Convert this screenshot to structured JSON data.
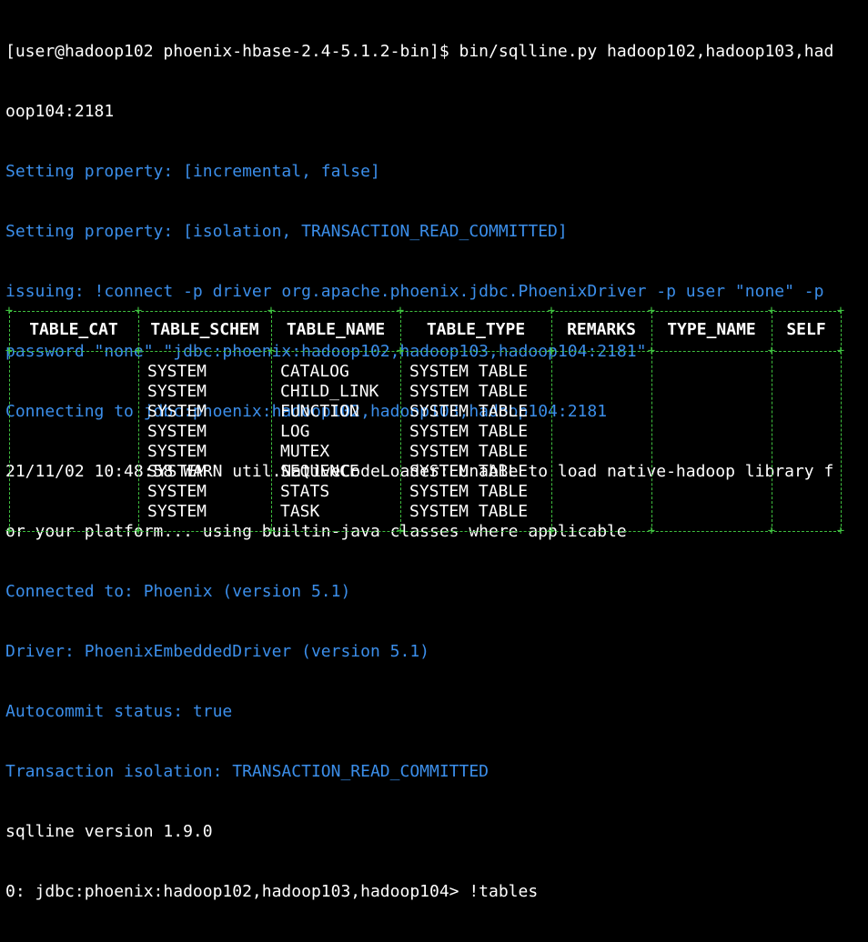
{
  "terminal": {
    "lines": [
      {
        "text": "[user@hadoop102 phoenix-hbase-2.4-5.1.2-bin]$ bin/sqlline.py hadoop102,hadoop103,had",
        "color": "white"
      },
      {
        "text": "oop104:2181",
        "color": "white"
      },
      {
        "text": "Setting property: [incremental, false]",
        "color": "blue"
      },
      {
        "text": "Setting property: [isolation, TRANSACTION_READ_COMMITTED]",
        "color": "blue"
      },
      {
        "text": "issuing: !connect -p driver org.apache.phoenix.jdbc.PhoenixDriver -p user \"none\" -p",
        "color": "blue"
      },
      {
        "text": "password \"none\" \"jdbc:phoenix:hadoop102,hadoop103,hadoop104:2181\"",
        "color": "blue"
      },
      {
        "text": "Connecting to jdbc:phoenix:hadoop102,hadoop103,hadoop104:2181",
        "color": "blue"
      },
      {
        "text": "21/11/02 10:48:58 WARN util.NativeCodeLoader: Unable to load native-hadoop library f",
        "color": "white"
      },
      {
        "text": "or your platform... using builtin-java classes where applicable",
        "color": "white"
      },
      {
        "text": "Connected to: Phoenix (version 5.1)",
        "color": "blue"
      },
      {
        "text": "Driver: PhoenixEmbeddedDriver (version 5.1)",
        "color": "blue"
      },
      {
        "text": "Autocommit status: true",
        "color": "blue"
      },
      {
        "text": "Transaction isolation: TRANSACTION_READ_COMMITTED",
        "color": "blue"
      },
      {
        "text": "sqlline version 1.9.0",
        "color": "white"
      },
      {
        "text": "0: jdbc:phoenix:hadoop102,hadoop103,hadoop104> !tables",
        "color": "white"
      }
    ],
    "colors": {
      "background": "#000000",
      "text": "#ffffff",
      "info": "#3b8eea",
      "table_border": "#3fbf3f"
    }
  },
  "table": {
    "headers": [
      "TABLE_CAT",
      "TABLE_SCHEM",
      "TABLE_NAME",
      "TABLE_TYPE",
      "REMARKS",
      "TYPE_NAME",
      "SELF"
    ],
    "rows": [
      [
        "",
        "SYSTEM",
        "CATALOG",
        "SYSTEM TABLE",
        "",
        "",
        ""
      ],
      [
        "",
        "SYSTEM",
        "CHILD_LINK",
        "SYSTEM TABLE",
        "",
        "",
        ""
      ],
      [
        "",
        "SYSTEM",
        "FUNCTION",
        "SYSTEM TABLE",
        "",
        "",
        ""
      ],
      [
        "",
        "SYSTEM",
        "LOG",
        "SYSTEM TABLE",
        "",
        "",
        ""
      ],
      [
        "",
        "SYSTEM",
        "MUTEX",
        "SYSTEM TABLE",
        "",
        "",
        ""
      ],
      [
        "",
        "SYSTEM",
        "SEQUENCE",
        "SYSTEM TABLE",
        "",
        "",
        ""
      ],
      [
        "",
        "SYSTEM",
        "STATS",
        "SYSTEM TABLE",
        "",
        "",
        ""
      ],
      [
        "",
        "SYSTEM",
        "TASK",
        "SYSTEM TABLE",
        "",
        "",
        ""
      ]
    ]
  }
}
